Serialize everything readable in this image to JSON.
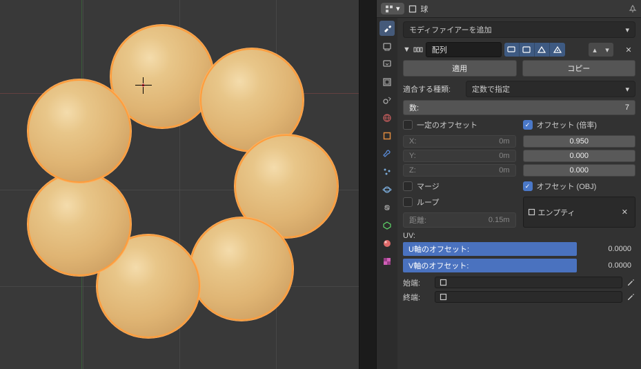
{
  "header": {
    "object_name": "球"
  },
  "add_modifier_label": "モディファイアーを追加",
  "modifier": {
    "name": "配列",
    "apply_label": "適用",
    "copy_label": "コピー",
    "fit_type_label": "適合する種類:",
    "fit_type_value": "定数で指定",
    "count_label": "数:",
    "count_value": "7",
    "constant_offset": {
      "label": "一定のオフセット",
      "enabled": false,
      "x_label": "X:",
      "x": "0m",
      "y_label": "Y:",
      "y": "0m",
      "z_label": "Z:",
      "z": "0m"
    },
    "relative_offset": {
      "label": "オフセット (倍率)",
      "enabled": true,
      "x": "0.950",
      "y": "0.000",
      "z": "0.000"
    },
    "merge": {
      "label": "マージ",
      "enabled": false
    },
    "loop": {
      "label": "ループ",
      "enabled": false
    },
    "distance_label": "距離:",
    "distance_value": "0.15m",
    "object_offset": {
      "label": "オフセット (OBJ)",
      "enabled": true
    },
    "object_offset_target": "エンプティ",
    "uv_section_label": "UV:",
    "u_offset_label": "U軸のオフセット:",
    "u_offset_value": "0.0000",
    "v_offset_label": "V軸のオフセット:",
    "v_offset_value": "0.0000",
    "start_cap_label": "始端:",
    "end_cap_label": "終端:"
  }
}
